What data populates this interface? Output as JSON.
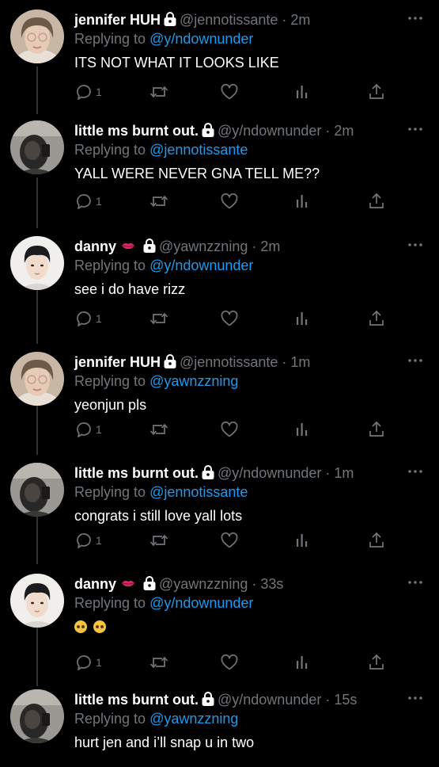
{
  "tweets": [
    {
      "name": "jennifer HUH",
      "handle": "@jennotissante",
      "time": "2m",
      "replying_label": "Replying to",
      "replying_to": "@y/ndownunder",
      "text": "ITS NOT WHAT IT LOOKS LIKE",
      "reply_count": "1",
      "avatar": "woman-glasses"
    },
    {
      "name": "little ms burnt out.",
      "handle": "@y/ndownunder",
      "time": "2m",
      "replying_label": "Replying to",
      "replying_to": "@jennotissante",
      "text": "YALL WERE NEVER GNA TELL ME??",
      "reply_count": "1",
      "avatar": "dark-selfie"
    },
    {
      "name": "danny",
      "name_emoji": "lips",
      "handle": "@yawnzzning",
      "time": "2m",
      "replying_label": "Replying to",
      "replying_to": "@y/ndownunder",
      "text": "see i do have rizz",
      "reply_count": "1",
      "avatar": "young-man"
    },
    {
      "name": "jennifer HUH",
      "handle": "@jennotissante",
      "time": "1m",
      "replying_label": "Replying to",
      "replying_to": "@yawnzzning",
      "text": "yeonjun pls",
      "reply_count": "1",
      "avatar": "woman-glasses"
    },
    {
      "name": "little ms burnt out.",
      "handle": "@y/ndownunder",
      "time": "1m",
      "replying_label": "Replying to",
      "replying_to": "@jennotissante",
      "text": "congrats i still love yall lots",
      "reply_count": "1",
      "avatar": "dark-selfie"
    },
    {
      "name": "danny",
      "name_emoji": "lips",
      "handle": "@yawnzzning",
      "time": "33s",
      "replying_label": "Replying to",
      "replying_to": "@y/ndownunder",
      "text": "",
      "text_emojis": [
        "pleading-face",
        "pleading-face"
      ],
      "reply_count": "1",
      "avatar": "young-man"
    },
    {
      "name": "little ms burnt out.",
      "handle": "@y/ndownunder",
      "time": "15s",
      "replying_label": "Replying to",
      "replying_to": "@yawnzzning",
      "text": "hurt jen and i’ll snap u in two",
      "reply_count": "",
      "avatar": "dark-selfie"
    }
  ],
  "dot": "·",
  "icons": {
    "lock": "lock-icon",
    "more": "more-icon",
    "reply": "reply-icon",
    "retweet": "retweet-icon",
    "like": "heart-icon",
    "views": "views-icon",
    "share": "share-icon",
    "lips": "lips-emoji"
  },
  "colors": {
    "background": "#000000",
    "text": "#ffffff",
    "muted": "#71767b",
    "link": "#1d9bf0",
    "thread_line": "#2f3336"
  }
}
